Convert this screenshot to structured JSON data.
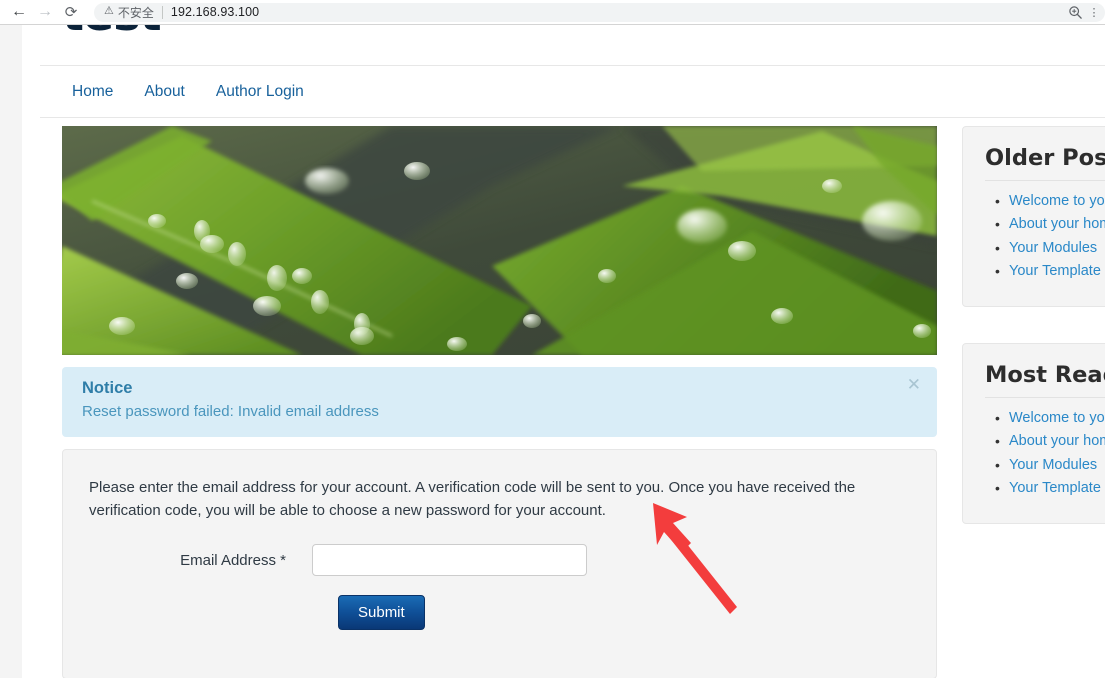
{
  "browser": {
    "back_icon": "back-arrow-icon",
    "forward_icon": "forward-arrow-icon",
    "reload_icon": "reload-icon",
    "security_icon": "warning-triangle-icon",
    "security_label": "不安全",
    "url": "192.168.93.100",
    "zoom_icon": "zoom-magnifier-icon",
    "menu_icon": "browser-menu-icon"
  },
  "site": {
    "logo_text": "test"
  },
  "nav": {
    "items": [
      {
        "label": "Home"
      },
      {
        "label": "About"
      },
      {
        "label": "Author Login"
      }
    ]
  },
  "hero": {
    "alt": "green-leaves-with-water-droplets"
  },
  "notice": {
    "title": "Notice",
    "message": "Reset password failed: Invalid email address",
    "close_icon": "close-x-icon"
  },
  "form": {
    "description": "Please enter the email address for your account. A verification code will be sent to you. Once you have received the verification code, you will be able to choose a new password for your account.",
    "email_label": "Email Address *",
    "email_value": "",
    "email_placeholder": "",
    "submit_label": "Submit"
  },
  "sidebar": {
    "boxes": [
      {
        "title": "Older Posts",
        "items": [
          "Welcome to your blog!",
          "About your home page",
          "Your Modules",
          "Your Template"
        ]
      },
      {
        "title": "Most Read Posts",
        "items": [
          "Welcome to your blog!",
          "About your home page",
          "Your Modules",
          "Your Template"
        ]
      }
    ]
  },
  "annotation": {
    "arrow_color": "#f33d3d",
    "arrow_name": "red-pointer-arrow"
  },
  "colors": {
    "link": "#18619b",
    "notice_bg": "#d9edf7",
    "notice_title": "#2f7ea8",
    "panel_bg": "#f4f4f4",
    "submit_top": "#1a6cb5",
    "submit_bottom": "#0a3876",
    "sidebar_link": "#2a88c8"
  }
}
